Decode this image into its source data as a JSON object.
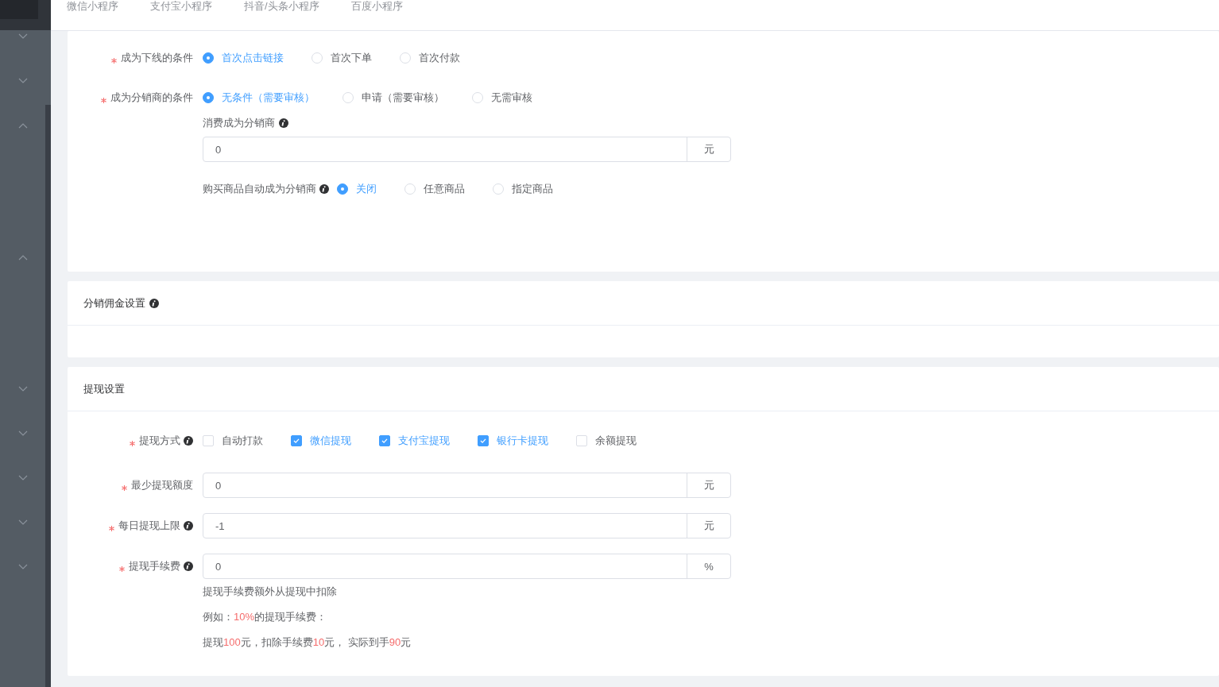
{
  "sidebar": {
    "items": [
      {
        "expanded": false
      },
      {
        "expanded": false
      },
      {
        "expanded": true
      },
      {
        "expanded": true
      },
      {
        "expanded": false
      },
      {
        "expanded": false
      },
      {
        "expanded": false
      },
      {
        "expanded": false
      },
      {
        "expanded": false
      }
    ]
  },
  "tabs": [
    {
      "label": "微信小程序"
    },
    {
      "label": "支付宝小程序"
    },
    {
      "label": "抖音/头条小程序"
    },
    {
      "label": "百度小程序"
    }
  ],
  "sections": [
    {
      "fields": [
        {
          "kind": "radio",
          "label": "成为下线的条件",
          "required": true,
          "info": false,
          "options": [
            {
              "label": "首次点击链接",
              "selected": true
            },
            {
              "label": "首次下单",
              "selected": false
            },
            {
              "label": "首次付款",
              "selected": false
            }
          ]
        },
        {
          "kind": "radio",
          "label": "成为分销商的条件",
          "required": true,
          "info": false,
          "options": [
            {
              "label": "无条件（需要审核）",
              "selected": true
            },
            {
              "label": "申请（需要审核）",
              "selected": false
            },
            {
              "label": "无需审核",
              "selected": false
            }
          ]
        },
        {
          "kind": "caption",
          "label": "消费成为分销商",
          "info": true
        },
        {
          "kind": "input",
          "value": "0",
          "suffix": "元"
        },
        {
          "kind": "inline-radio",
          "label": "购买商品自动成为分销商",
          "info": true,
          "options": [
            {
              "label": "关闭",
              "selected": true
            },
            {
              "label": "任意商品",
              "selected": false
            },
            {
              "label": "指定商品",
              "selected": false
            }
          ]
        }
      ]
    },
    {
      "title": "分销佣金设置",
      "info": true
    },
    {
      "title": "提现设置",
      "info": false,
      "fields": [
        {
          "kind": "checkbox",
          "label": "提现方式",
          "required": true,
          "info": true,
          "options": [
            {
              "label": "自动打款",
              "checked": false
            },
            {
              "label": "微信提现",
              "checked": true
            },
            {
              "label": "支付宝提现",
              "checked": true
            },
            {
              "label": "银行卡提现",
              "checked": true
            },
            {
              "label": "余额提现",
              "checked": false
            }
          ]
        },
        {
          "kind": "input",
          "label": "最少提现额度",
          "required": true,
          "info": false,
          "value": "0",
          "suffix": "元"
        },
        {
          "kind": "input",
          "label": "每日提现上限",
          "required": true,
          "info": true,
          "value": "-1",
          "suffix": "元"
        },
        {
          "kind": "input",
          "label": "提现手续费",
          "required": true,
          "info": true,
          "value": "0",
          "suffix": "%"
        },
        {
          "kind": "note",
          "segments": [
            {
              "text": "提现手续费额外从提现中扣除",
              "highlight": false
            }
          ]
        },
        {
          "kind": "note",
          "segments": [
            {
              "text": "例如：",
              "highlight": false
            },
            {
              "text": "10%",
              "highlight": true
            },
            {
              "text": "的提现手续费：",
              "highlight": false
            }
          ]
        },
        {
          "kind": "note",
          "segments": [
            {
              "text": "提现",
              "highlight": false
            },
            {
              "text": "100",
              "highlight": true
            },
            {
              "text": "元，扣除手续费",
              "highlight": false
            },
            {
              "text": "10",
              "highlight": true
            },
            {
              "text": "元， 实际到手",
              "highlight": false
            },
            {
              "text": "90",
              "highlight": true
            },
            {
              "text": "元",
              "highlight": false
            }
          ]
        }
      ]
    }
  ]
}
